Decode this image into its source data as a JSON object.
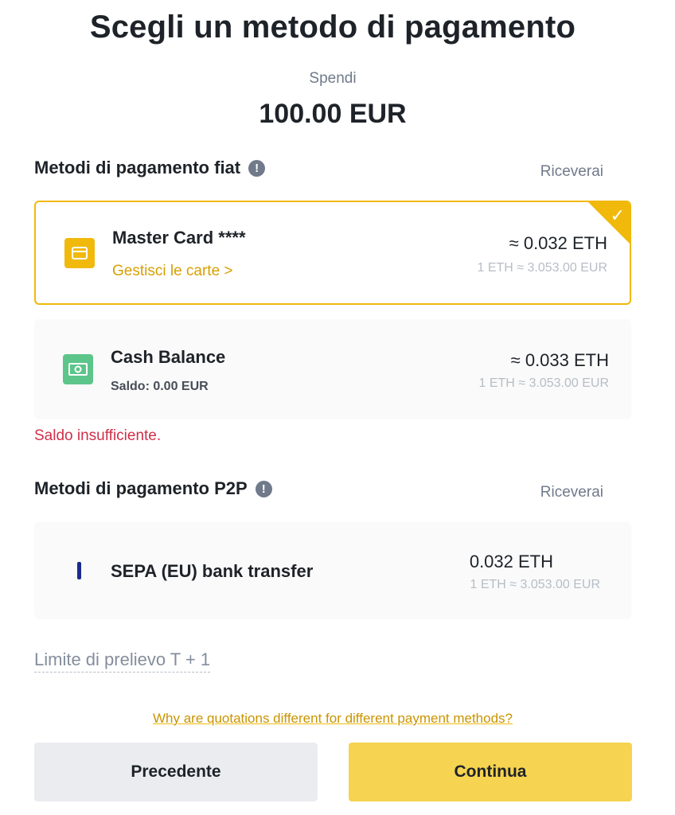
{
  "header": {
    "title": "Scegli un metodo di pagamento",
    "spend_label": "Spendi",
    "spend_amount": "100.00 EUR"
  },
  "fiat": {
    "section_title": "Metodi di pagamento fiat",
    "info_icon": "!",
    "receive_label": "Riceverai",
    "methods": [
      {
        "name": "Master Card ****",
        "icon": "card-icon",
        "link": "Gestisci le carte >",
        "amount": "≈ 0.032 ETH",
        "rate": "1 ETH ≈ 3.053.00 EUR",
        "selected": true,
        "check": "✓"
      },
      {
        "name": "Cash Balance",
        "icon": "cash-icon",
        "subtitle": "Saldo: 0.00 EUR",
        "amount": "≈ 0.033 ETH",
        "rate": "1 ETH ≈ 3.053.00 EUR",
        "selected": false
      }
    ],
    "error": "Saldo insufficiente."
  },
  "p2p": {
    "section_title": "Metodi di pagamento P2P",
    "info_icon": "!",
    "receive_label": "Riceverai",
    "methods": [
      {
        "name": "SEPA (EU) bank transfer",
        "icon": "sepa-bar-icon",
        "amount": "0.032 ETH",
        "rate": "1 ETH ≈ 3.053.00 EUR"
      }
    ]
  },
  "limit_link": "Limite di prelievo T + 1",
  "quote_link": "Why are quotations different for different payment methods?",
  "buttons": {
    "back": "Precedente",
    "continue": "Continua"
  },
  "colors": {
    "accent": "#f0b90b",
    "primary_button": "#f6d350",
    "error": "#cf304a",
    "cash_icon": "#5cc58a",
    "sepa_bar": "#1a2b8c"
  }
}
